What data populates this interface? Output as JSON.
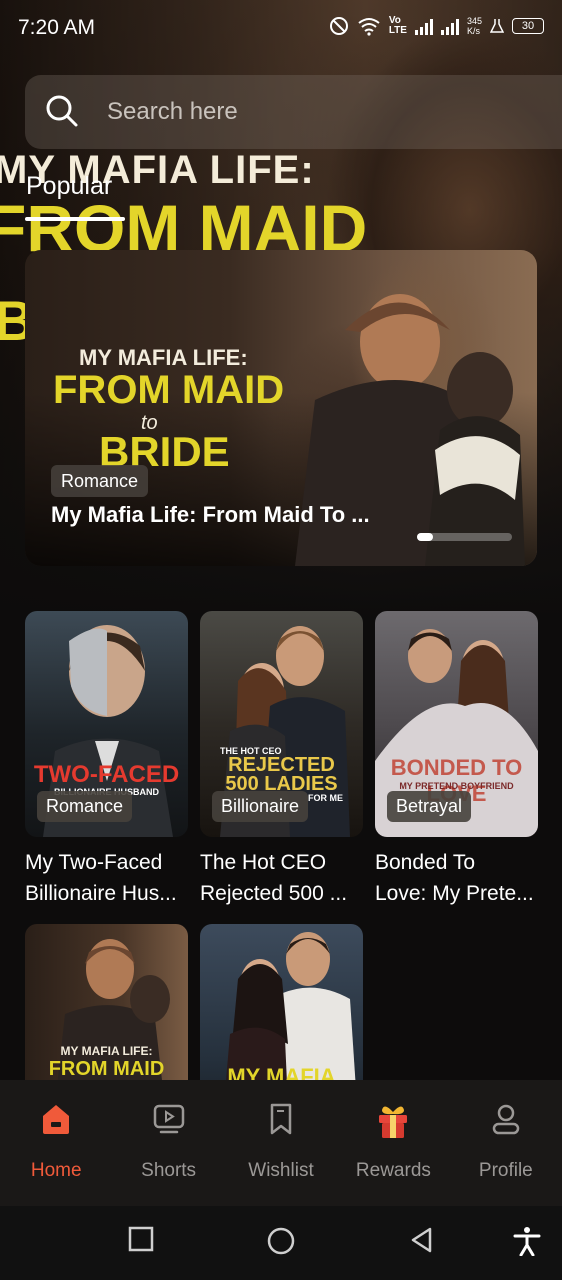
{
  "status_bar": {
    "time": "7:20 AM",
    "net_top": "Vo",
    "net_bottom": "LTE",
    "speed_top": "345",
    "speed_bottom": "K/s",
    "battery": "30"
  },
  "search": {
    "placeholder": "Search here"
  },
  "section": {
    "popular_label": "Popular"
  },
  "hero_background": {
    "line1": "MY MAFIA LIFE:",
    "line2": "FROM MAID",
    "line3": "B"
  },
  "featured": {
    "cover_line1": "MY MAFIA LIFE:",
    "cover_line2": "FROM MAID",
    "cover_line3": "to",
    "cover_line4": "BRIDE",
    "genre": "Romance",
    "title": "My Mafia Life: From Maid To ..."
  },
  "books": [
    {
      "genre": "Romance",
      "title_l1": "My Two-Faced",
      "title_l2": "Billionaire Hus...",
      "cover_text": "TWO-FACED",
      "cover_sub": "BILLIONAIRE HUSBAND"
    },
    {
      "genre": "Billionaire",
      "title_l1": "The Hot CEO",
      "title_l2": "Rejected 500 ...",
      "cover_small": "THE HOT CEO",
      "cover_text": "REJECTED",
      "cover_text2": "500 LADIES",
      "cover_sub": "FOR ME"
    },
    {
      "genre": "Betrayal",
      "title_l1": "Bonded To",
      "title_l2": "Love: My Prete...",
      "cover_text": "BONDED TO LOVE",
      "cover_sub": "MY PRETEND BOYFRIEND"
    },
    {
      "cover_text_top": "MY MAFIA LIFE:",
      "cover_text": "FROM MAID"
    },
    {
      "cover_text": "MY MAFIA"
    }
  ],
  "nav": {
    "home": "Home",
    "shorts": "Shorts",
    "wishlist": "Wishlist",
    "rewards": "Rewards",
    "profile": "Profile"
  },
  "colors": {
    "accent": "#f05a3a",
    "cover_yellow": "#e3d52a",
    "background": "#0d0c0c"
  }
}
